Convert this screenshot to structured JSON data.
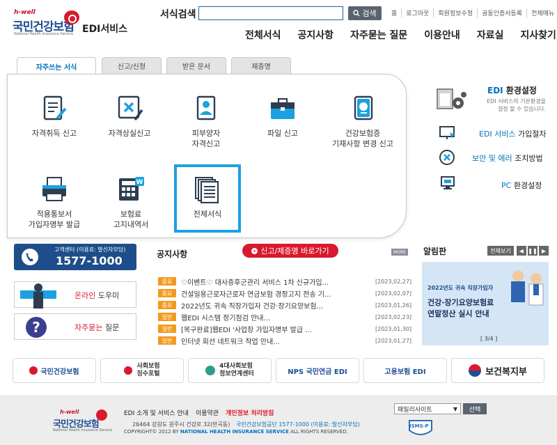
{
  "header": {
    "logo_hwell": "h-well",
    "logo_main": "국민건강보험",
    "logo_sub": "National Health Insurance Service",
    "edi_title": "EDI서비스",
    "search_label": "서식검색",
    "search_value": "",
    "search_button": "검색",
    "top_links": [
      "홈",
      "로그아웃",
      "회원정보수정",
      "공동인증서등록",
      "전체메뉴"
    ],
    "main_nav": [
      "전체서식",
      "공지사항",
      "자주묻는 질문",
      "이용안내",
      "자료실",
      "지사찾기"
    ]
  },
  "tabs": [
    "자주쓰는 서식",
    "신고/신청",
    "받은 문서",
    "제증명"
  ],
  "forms": [
    {
      "label": "자격취득 신고",
      "icon": "document-edit-icon"
    },
    {
      "label": "자격상실신고",
      "icon": "document-cancel-icon"
    },
    {
      "label": "피부양자\n자격신고",
      "icon": "person-document-icon"
    },
    {
      "label": "파일 신고",
      "icon": "briefcase-icon"
    },
    {
      "label": "건강보험증\n기재사항 변경 신고",
      "icon": "card-edit-icon"
    },
    {
      "label": "적용통보서\n가입자명부 발급",
      "icon": "printer-icon"
    },
    {
      "label": "보험료\n고지내역서",
      "icon": "calculator-icon"
    },
    {
      "label": "전체서식",
      "icon": "document-stack-icon"
    }
  ],
  "env": {
    "title_blue": "EDI",
    "title_rest": " 환경설정",
    "desc": "EDI 서비스의 기본환경을\n설정 할 수 있습니다.",
    "items": [
      {
        "blue": "EDI 서비스",
        "rest": " 가입절차",
        "icon": "monitor-cursor-icon"
      },
      {
        "blue": "보안 및 에러",
        "rest": " 조치방법",
        "icon": "error-x-icon"
      },
      {
        "blue": "PC",
        "rest": " 환경설정",
        "icon": "pc-icon"
      }
    ]
  },
  "call_center": {
    "label": "고객센터 (이용료: 발신자부담)",
    "number": "1577-1000"
  },
  "side_boxes": [
    {
      "blue": "온라인",
      "rest": " 도우미",
      "icon": "helper-person-icon"
    },
    {
      "blue": "자주묻는",
      "rest": " 질문",
      "icon": "question-icon"
    }
  ],
  "notice": {
    "title": "공지사항",
    "red_button": "신고/제증명 바로가기",
    "more": "MORE",
    "items": [
      {
        "badge": "중요",
        "title": "♡이벤트♡ 대사증후군관리 서비스 1차 신규가입...",
        "date": "[2023,02,27]"
      },
      {
        "badge": "중요",
        "title": "건설일용근로자근로자 연금보험 경정고지 전송 기...",
        "date": "[2023,02,07]"
      },
      {
        "badge": "중요",
        "title": "2022년도 귀속 직장가입자 건강·장기요양보험...",
        "date": "[2023,01,26]"
      },
      {
        "badge": "일반",
        "title": "웹EDI 시스템 정기점검 안내...",
        "date": "[2023,02,23]"
      },
      {
        "badge": "일반",
        "title": "[복구완료]웹EDI '사업장 가입자명부 발급 ...",
        "date": "[2023,01,30]"
      },
      {
        "badge": "일반",
        "title": "인터넷 회선 네트워크 작업 안내...",
        "date": "[2023,01,27]"
      }
    ]
  },
  "alim": {
    "title": "알림판",
    "view_all": "전체보기",
    "banner_top": "2022년도 귀속 직장가입자",
    "banner_line1": "건강·장기요양보험료",
    "banner_line2": "연말정산 실시 안내",
    "page": "[ 3/4 ]"
  },
  "partners": [
    {
      "label": "국민건강보험"
    },
    {
      "label": "사회보험\n징수포털"
    },
    {
      "label": "4대사회보험\n정보연계센터"
    },
    {
      "label": "NPS 국민연금 EDI"
    },
    {
      "label": "고용보험 EDI"
    },
    {
      "label": "보건복지부"
    }
  ],
  "footer": {
    "links": [
      "EDI 소개 및 서비스 안내",
      "이용약관",
      "개인정보 처리방침"
    ],
    "address_pre": "26464 강원도 원주시 건강로 32(반곡동)",
    "address_blue": "국민건강보험공단 1577-1000 (이용료: 발신자부담)",
    "copyright_pre": "COPYRIGHT© 2012 BY",
    "copyright_blue": "NATIONAL HEALTH INSURANCE SERVICE",
    "copyright_post": "ALL RIGHTS RESERVED.",
    "family_site": "패밀리사이트",
    "family_button": "선택",
    "ismsp": "ISMS-P"
  },
  "colors": {
    "accent": "#0072bc",
    "highlight": "#1ba1e2",
    "red": "#d9192d",
    "navy": "#1d4d8a"
  }
}
